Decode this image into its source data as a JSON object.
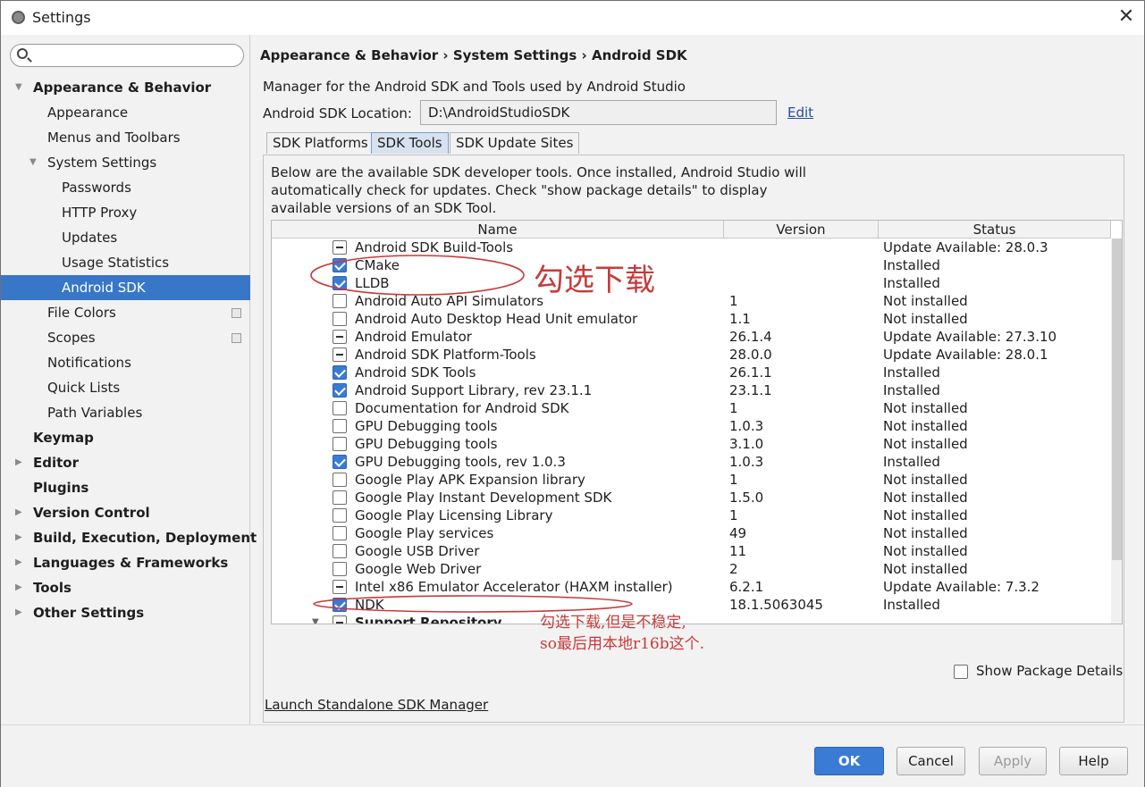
{
  "window": {
    "title": "Settings"
  },
  "search": {
    "value": "",
    "placeholder": ""
  },
  "sidebar": {
    "items": [
      {
        "label": "Appearance & Behavior",
        "level": 0,
        "bold": true,
        "arrow": "down"
      },
      {
        "label": "Appearance",
        "level": 1
      },
      {
        "label": "Menus and Toolbars",
        "level": 1
      },
      {
        "label": "System Settings",
        "level": 1,
        "arrow": "down"
      },
      {
        "label": "Passwords",
        "level": 2
      },
      {
        "label": "HTTP Proxy",
        "level": 2
      },
      {
        "label": "Updates",
        "level": 2
      },
      {
        "label": "Usage Statistics",
        "level": 2
      },
      {
        "label": "Android SDK",
        "level": 2,
        "selected": true
      },
      {
        "label": "File Colors",
        "level": 1,
        "copy_icon": true
      },
      {
        "label": "Scopes",
        "level": 1,
        "copy_icon": true
      },
      {
        "label": "Notifications",
        "level": 1
      },
      {
        "label": "Quick Lists",
        "level": 1
      },
      {
        "label": "Path Variables",
        "level": 1
      },
      {
        "label": "Keymap",
        "level": 0,
        "bold": true
      },
      {
        "label": "Editor",
        "level": 0,
        "bold": true,
        "arrow": "right"
      },
      {
        "label": "Plugins",
        "level": 0,
        "bold": true
      },
      {
        "label": "Version Control",
        "level": 0,
        "bold": true,
        "arrow": "right"
      },
      {
        "label": "Build, Execution, Deployment",
        "level": 0,
        "bold": true,
        "arrow": "right"
      },
      {
        "label": "Languages & Frameworks",
        "level": 0,
        "bold": true,
        "arrow": "right"
      },
      {
        "label": "Tools",
        "level": 0,
        "bold": true,
        "arrow": "right"
      },
      {
        "label": "Other Settings",
        "level": 0,
        "bold": true,
        "arrow": "right"
      }
    ]
  },
  "main": {
    "breadcrumb": "Appearance & Behavior › System Settings › Android SDK",
    "description": "Manager for the Android SDK and Tools used by Android Studio",
    "location_label": "Android SDK Location:",
    "location_value": "D:\\AndroidStudioSDK",
    "edit_label": "Edit",
    "tabs": [
      {
        "label": "SDK Platforms"
      },
      {
        "label": "SDK Tools",
        "active": true
      },
      {
        "label": "SDK Update Sites"
      }
    ],
    "panel_text_lines": [
      "Below are the available SDK developer tools. Once installed, Android Studio will",
      "automatically check for updates. Check \"show package details\" to display",
      "available versions of an SDK Tool."
    ],
    "table": {
      "columns": [
        "Name",
        "Version",
        "Status"
      ],
      "rows": [
        {
          "state": "partial",
          "name": "Android SDK Build-Tools",
          "version": "",
          "status": "Update Available: 28.0.3"
        },
        {
          "state": "checked",
          "name": "CMake",
          "version": "",
          "status": "Installed"
        },
        {
          "state": "checked",
          "name": "LLDB",
          "version": "",
          "status": "Installed"
        },
        {
          "state": "unchecked",
          "name": "Android Auto API Simulators",
          "version": "1",
          "status": "Not installed"
        },
        {
          "state": "unchecked",
          "name": "Android Auto Desktop Head Unit emulator",
          "version": "1.1",
          "status": "Not installed"
        },
        {
          "state": "partial",
          "name": "Android Emulator",
          "version": "26.1.4",
          "status": "Update Available: 27.3.10"
        },
        {
          "state": "partial",
          "name": "Android SDK Platform-Tools",
          "version": "28.0.0",
          "status": "Update Available: 28.0.1"
        },
        {
          "state": "checked",
          "name": "Android SDK Tools",
          "version": "26.1.1",
          "status": "Installed"
        },
        {
          "state": "checked",
          "name": "Android Support Library, rev 23.1.1",
          "version": "23.1.1",
          "status": "Installed"
        },
        {
          "state": "unchecked",
          "name": "Documentation for Android SDK",
          "version": "1",
          "status": "Not installed"
        },
        {
          "state": "unchecked",
          "name": "GPU Debugging tools",
          "version": "1.0.3",
          "status": "Not installed"
        },
        {
          "state": "unchecked",
          "name": "GPU Debugging tools",
          "version": "3.1.0",
          "status": "Not installed"
        },
        {
          "state": "checked",
          "name": "GPU Debugging tools, rev 1.0.3",
          "version": "1.0.3",
          "status": "Installed"
        },
        {
          "state": "unchecked",
          "name": "Google Play APK Expansion library",
          "version": "1",
          "status": "Not installed"
        },
        {
          "state": "unchecked",
          "name": "Google Play Instant Development SDK",
          "version": "1.5.0",
          "status": "Not installed"
        },
        {
          "state": "unchecked",
          "name": "Google Play Licensing Library",
          "version": "1",
          "status": "Not installed"
        },
        {
          "state": "unchecked",
          "name": "Google Play services",
          "version": "49",
          "status": "Not installed"
        },
        {
          "state": "unchecked",
          "name": "Google USB Driver",
          "version": "11",
          "status": "Not installed"
        },
        {
          "state": "unchecked",
          "name": "Google Web Driver",
          "version": "2",
          "status": "Not installed"
        },
        {
          "state": "partial",
          "name": "Intel x86 Emulator Accelerator (HAXM installer)",
          "version": "6.2.1",
          "status": "Update Available: 7.3.2"
        },
        {
          "state": "checked",
          "name": "NDK",
          "version": "18.1.5063045",
          "status": "Installed"
        },
        {
          "state": "partial",
          "name": "Support Repository",
          "version": "",
          "status": "",
          "section": true
        }
      ]
    },
    "show_package_details_label": "Show Package Details",
    "launch_link": "Launch Standalone SDK Manager"
  },
  "footer": {
    "ok_label": "OK",
    "cancel_label": "Cancel",
    "apply_label": "Apply",
    "help_label": "Help"
  },
  "annotations": {
    "note1": "勾选下载",
    "note2_line1": "勾选下载,但是不稳定,",
    "note2_line2": "so最后用本地r16b这个."
  },
  "colors": {
    "accent": "#3a7bd5",
    "selection": "#3876c8",
    "annotation": "#c83a3a"
  }
}
